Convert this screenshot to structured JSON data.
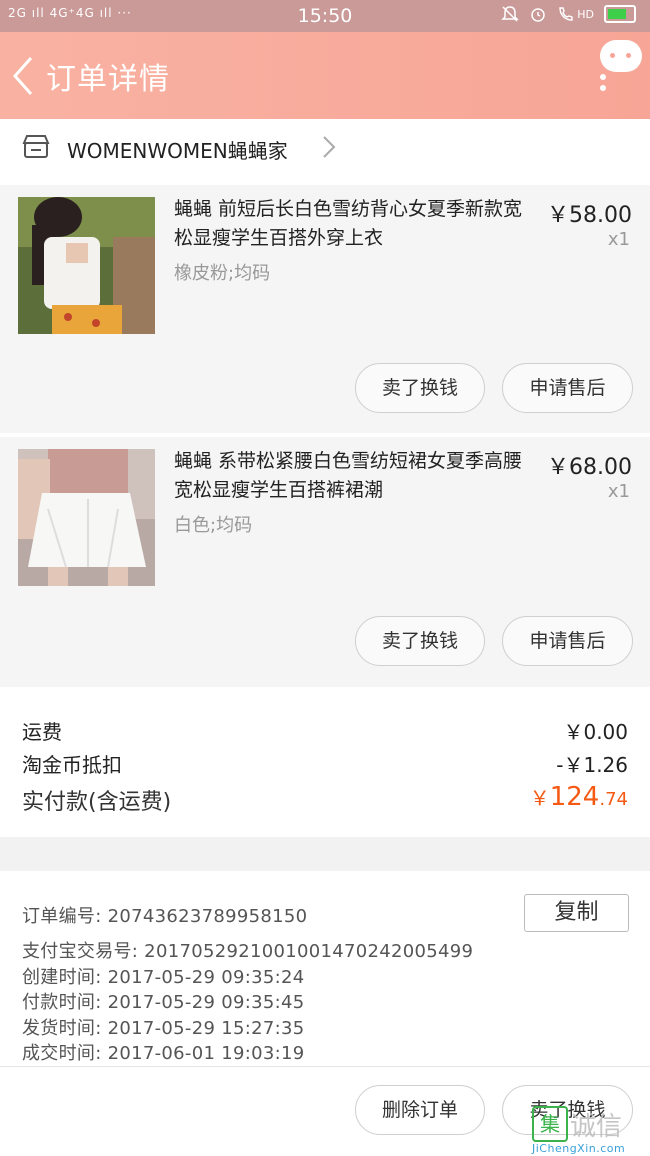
{
  "status_bar": {
    "network": "2G ıll 4G⁺4G ıll ···",
    "time": "15:50",
    "hd": "HD"
  },
  "nav": {
    "title": "订单详情"
  },
  "shop": {
    "name": "WOMENWOMEN蝇蝇家"
  },
  "items": [
    {
      "title": "蝇蝇 前短后长白色雪纺背心女夏季新款宽松显瘦学生百搭外穿上衣",
      "sku": "橡皮粉;均码",
      "price": "￥58.00",
      "qty": "x1",
      "btn_sell": "卖了换钱",
      "btn_after_sale": "申请售后"
    },
    {
      "title": "蝇蝇 系带松紧腰白色雪纺短裙女夏季高腰宽松显瘦学生百搭裤裙潮",
      "sku": "白色;均码",
      "price": "￥68.00",
      "qty": "x1",
      "btn_sell": "卖了换钱",
      "btn_after_sale": "申请售后"
    }
  ],
  "summary": {
    "shipping_label": "运费",
    "shipping_value": "￥0.00",
    "coin_label": "淘金币抵扣",
    "coin_value": "-￥1.26",
    "total_label": "实付款(含运费)",
    "total_currency": "￥",
    "total_int": "124",
    "total_dec": ".74",
    "accent_color": "#f55a14"
  },
  "order_info": {
    "order_no": "订单编号:  20743623789958150",
    "copy_label": "复制",
    "alipay_no": "支付宝交易号:  2017052921001001470242005499",
    "created": "创建时间:  2017-05-29  09:35:24",
    "paid": "付款时间:  2017-05-29  09:35:45",
    "shipped": "发货时间:  2017-05-29  15:27:35",
    "completed": "成交时间:  2017-06-01  19:03:19"
  },
  "footer": {
    "delete_label": "删除订单",
    "sell_label": "卖了换钱"
  },
  "watermark": {
    "char": "集",
    "cn": "诚信",
    "en": "JiChengXin.com"
  },
  "colors": {
    "nav_gradient_start": "#f9b2a2",
    "nav_gradient_end": "#f7a596",
    "status_bar": "#c99a98"
  }
}
